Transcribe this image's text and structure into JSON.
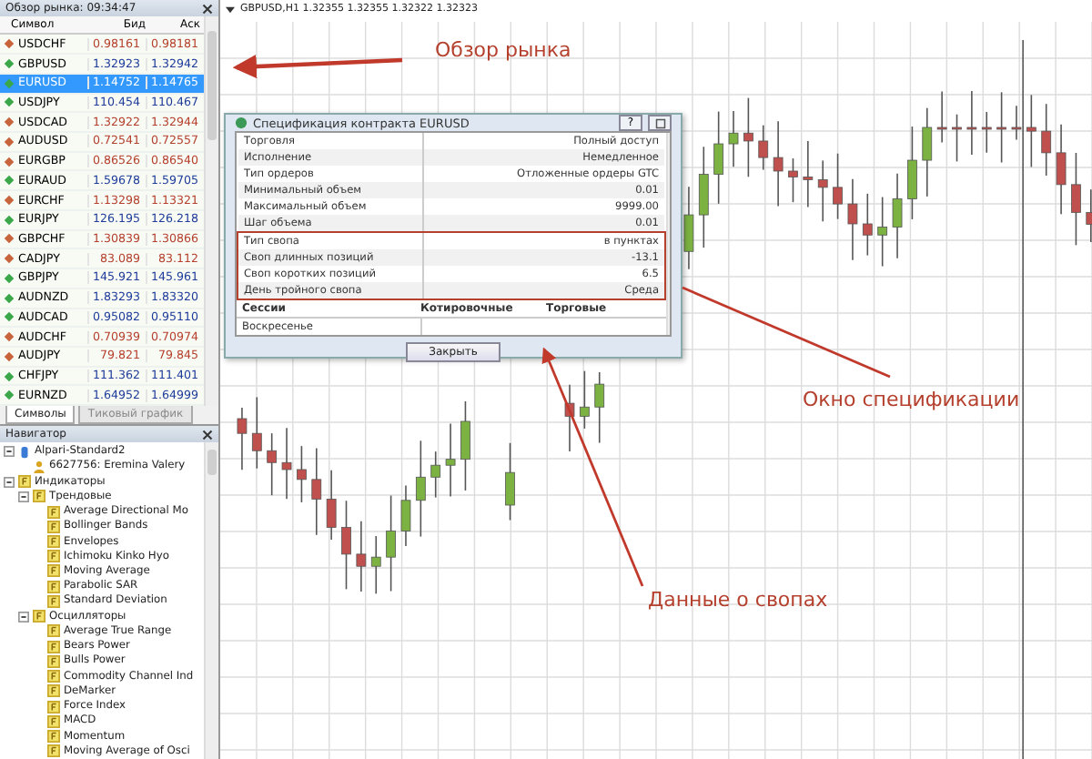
{
  "market_watch": {
    "title": "Обзор рынка: 09:34:47",
    "columns": [
      "Символ",
      "Бид",
      "Аск"
    ],
    "rows": [
      {
        "symbol": "USDCHF",
        "bid": "0.98161",
        "ask": "0.98181",
        "rising": false,
        "selected": false
      },
      {
        "symbol": "GBPUSD",
        "bid": "1.32923",
        "ask": "1.32942",
        "rising": true,
        "selected": false
      },
      {
        "symbol": "EURUSD",
        "bid": "1.14752",
        "ask": "1.14765",
        "rising": true,
        "selected": true
      },
      {
        "symbol": "USDJPY",
        "bid": "110.454",
        "ask": "110.467",
        "rising": true,
        "selected": false
      },
      {
        "symbol": "USDCAD",
        "bid": "1.32922",
        "ask": "1.32944",
        "rising": false,
        "selected": false
      },
      {
        "symbol": "AUDUSD",
        "bid": "0.72541",
        "ask": "0.72557",
        "rising": false,
        "selected": false
      },
      {
        "symbol": "EURGBP",
        "bid": "0.86526",
        "ask": "0.86540",
        "rising": false,
        "selected": false
      },
      {
        "symbol": "EURAUD",
        "bid": "1.59678",
        "ask": "1.59705",
        "rising": true,
        "selected": false
      },
      {
        "symbol": "EURCHF",
        "bid": "1.13298",
        "ask": "1.13321",
        "rising": false,
        "selected": false
      },
      {
        "symbol": "EURJPY",
        "bid": "126.195",
        "ask": "126.218",
        "rising": true,
        "selected": false
      },
      {
        "symbol": "GBPCHF",
        "bid": "1.30839",
        "ask": "1.30866",
        "rising": false,
        "selected": false
      },
      {
        "symbol": "CADJPY",
        "bid": "83.089",
        "ask": "83.112",
        "rising": false,
        "selected": false
      },
      {
        "symbol": "GBPJPY",
        "bid": "145.921",
        "ask": "145.961",
        "rising": true,
        "selected": false
      },
      {
        "symbol": "AUDNZD",
        "bid": "1.83293",
        "ask": "1.83320",
        "rising": true,
        "selected": false
      },
      {
        "symbol": "AUDCAD",
        "bid": "0.95082",
        "ask": "0.95110",
        "rising": true,
        "selected": false
      },
      {
        "symbol": "AUDCHF",
        "bid": "0.70939",
        "ask": "0.70974",
        "rising": false,
        "selected": false
      },
      {
        "symbol": "AUDJPY",
        "bid": "79.821",
        "ask": "79.845",
        "rising": false,
        "selected": false
      },
      {
        "symbol": "CHFJPY",
        "bid": "111.362",
        "ask": "111.401",
        "rising": true,
        "selected": false
      },
      {
        "symbol": "EURNZD",
        "bid": "1.64952",
        "ask": "1.64999",
        "rising": true,
        "selected": false
      }
    ],
    "tabs": [
      {
        "label": "Символы",
        "selected": true
      },
      {
        "label": "Тиковый график",
        "selected": false
      }
    ]
  },
  "navigator": {
    "title": "Навигатор",
    "tree": [
      {
        "kind": "server",
        "label": "Alpari-Standard2",
        "expanded": true,
        "children": [
          {
            "kind": "account",
            "label": "6627756: Eremina Valery"
          }
        ]
      },
      {
        "kind": "folder",
        "label": "Индикаторы",
        "expanded": true,
        "children": [
          {
            "kind": "folder",
            "label": "Трендовые",
            "expanded": true,
            "children": [
              {
                "kind": "indicator",
                "label": "Average Directional Mo"
              },
              {
                "kind": "indicator",
                "label": "Bollinger Bands"
              },
              {
                "kind": "indicator",
                "label": "Envelopes"
              },
              {
                "kind": "indicator",
                "label": "Ichimoku Kinko Hyo"
              },
              {
                "kind": "indicator",
                "label": "Moving Average"
              },
              {
                "kind": "indicator",
                "label": "Parabolic SAR"
              },
              {
                "kind": "indicator",
                "label": "Standard Deviation"
              }
            ]
          },
          {
            "kind": "folder",
            "label": "Осцилляторы",
            "expanded": true,
            "children": [
              {
                "kind": "indicator",
                "label": "Average True Range"
              },
              {
                "kind": "indicator",
                "label": "Bears Power"
              },
              {
                "kind": "indicator",
                "label": "Bulls Power"
              },
              {
                "kind": "indicator",
                "label": "Commodity Channel Ind"
              },
              {
                "kind": "indicator",
                "label": "DeMarker"
              },
              {
                "kind": "indicator",
                "label": "Force Index"
              },
              {
                "kind": "indicator",
                "label": "MACD"
              },
              {
                "kind": "indicator",
                "label": "Momentum"
              },
              {
                "kind": "indicator",
                "label": "Moving Average of Osci"
              }
            ]
          }
        ]
      }
    ]
  },
  "chart": {
    "title": "GBPUSD,H1  1.32355 1.32355 1.32322 1.32323"
  },
  "dialog": {
    "title": "Спецификация контракта EURUSD",
    "help_button": "?",
    "rows": [
      {
        "label": "Торговля",
        "value": "Полный доступ",
        "highlighted": false
      },
      {
        "label": "Исполнение",
        "value": "Немедленное",
        "highlighted": false
      },
      {
        "label": "Тип ордеров",
        "value": "Отложенные ордеры GTC",
        "highlighted": false
      },
      {
        "label": "Минимальный объем",
        "value": "0.01",
        "highlighted": false
      },
      {
        "label": "Максимальный объем",
        "value": "9999.00",
        "highlighted": false
      },
      {
        "label": "Шаг объема",
        "value": "0.01",
        "highlighted": false
      },
      {
        "label": "Тип свопа",
        "value": "в пунктах",
        "highlighted": true
      },
      {
        "label": "Своп длинных позиций",
        "value": "-13.1",
        "highlighted": true
      },
      {
        "label": "Своп коротких позиций",
        "value": "6.5",
        "highlighted": true
      },
      {
        "label": "День тройного свопа",
        "value": "Среда",
        "highlighted": true
      }
    ],
    "session_columns": [
      "Сессии",
      "Котировочные",
      "Торговые"
    ],
    "session_rows": [
      "Воскресенье"
    ],
    "close_button": "Закрыть"
  },
  "annotations": [
    {
      "text": "Обзор рынка"
    },
    {
      "text": "Окно спецификации"
    },
    {
      "text": "Данные о свопах"
    }
  ]
}
